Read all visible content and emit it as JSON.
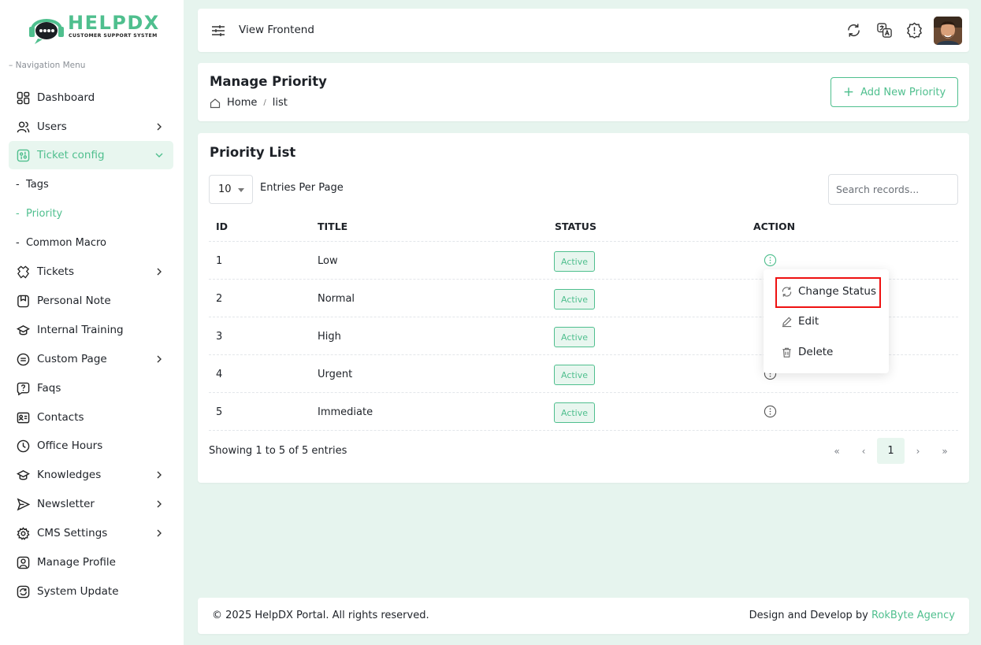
{
  "brand": {
    "name": "HELPDX",
    "tagline": "CUSTOMER SUPPORT SYSTEM",
    "accent": "#4fbf8e"
  },
  "sidebar": {
    "caption": "Navigation Menu",
    "items": [
      {
        "label": "Dashboard",
        "icon": "dashboard-icon"
      },
      {
        "label": "Users",
        "icon": "users-icon"
      },
      {
        "label": "Ticket config",
        "icon": "ticket-config-icon"
      },
      {
        "label": "Tickets",
        "icon": "tickets-icon"
      },
      {
        "label": "Personal Note",
        "icon": "note-icon"
      },
      {
        "label": "Internal Training",
        "icon": "training-icon"
      },
      {
        "label": "Custom Page",
        "icon": "custom-page-icon"
      },
      {
        "label": "Faqs",
        "icon": "faq-icon"
      },
      {
        "label": "Contacts",
        "icon": "contacts-icon"
      },
      {
        "label": "Office Hours",
        "icon": "clock-icon"
      },
      {
        "label": "Knowledges",
        "icon": "knowledge-icon"
      },
      {
        "label": "Newsletter",
        "icon": "newsletter-icon"
      },
      {
        "label": "CMS Settings",
        "icon": "gear-icon"
      },
      {
        "label": "Manage Profile",
        "icon": "profile-icon"
      },
      {
        "label": "System Update",
        "icon": "update-icon"
      }
    ],
    "subitems": [
      "Tags",
      "Priority",
      "Common Macro"
    ]
  },
  "topbar": {
    "view_frontend": "View Frontend"
  },
  "header": {
    "title": "Manage Priority",
    "breadcrumb": [
      "Home",
      "list"
    ],
    "add_button": "Add New Priority"
  },
  "list": {
    "title": "Priority List",
    "per_page": "10",
    "per_page_label": "Entries Per Page",
    "search_placeholder": "Search records...",
    "columns": [
      "ID",
      "TITLE",
      "STATUS",
      "ACTION"
    ],
    "rows": [
      {
        "id": "1",
        "title": "Low",
        "status": "Active"
      },
      {
        "id": "2",
        "title": "Normal",
        "status": "Active"
      },
      {
        "id": "3",
        "title": "High",
        "status": "Active"
      },
      {
        "id": "4",
        "title": "Urgent",
        "status": "Active"
      },
      {
        "id": "5",
        "title": "Immediate",
        "status": "Active"
      }
    ],
    "showing": "Showing 1 to 5 of 5 entries",
    "pager": {
      "first": "«",
      "prev": "‹",
      "current": "1",
      "next": "›",
      "last": "»"
    }
  },
  "dropdown": {
    "change_status": "Change Status",
    "edit": "Edit",
    "delete": "Delete"
  },
  "footer": {
    "copyright": "© 2025 HelpDX Portal. All rights reserved.",
    "developed_by": "Design and Develop by ",
    "agency": "RokByte Agency"
  }
}
